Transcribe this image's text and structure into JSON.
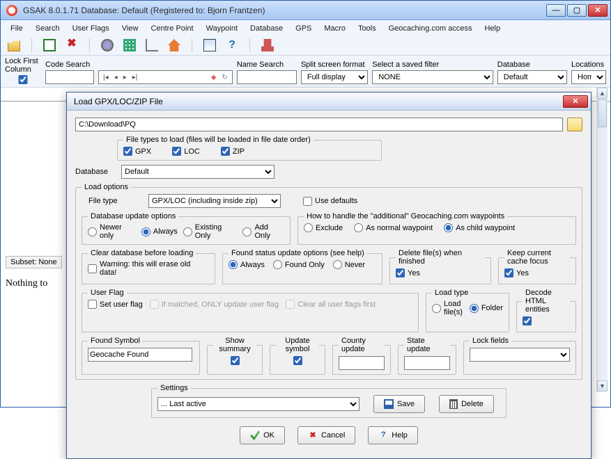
{
  "window": {
    "title": "GSAK 8.0.1.71   Database: Default    (Registered to: Bjorn Frantzen)"
  },
  "menu": [
    "File",
    "Search",
    "User Flags",
    "View",
    "Centre Point",
    "Waypoint",
    "Database",
    "GPS",
    "Macro",
    "Tools",
    "Geocaching.com access",
    "Help"
  ],
  "filters": {
    "lock_first": "Lock First\nColumn",
    "code_search": "Code Search",
    "name_search": "Name Search",
    "split_label": "Split screen format",
    "split_value": "Full display",
    "saved_filter_label": "Select a saved filter",
    "saved_filter_value": "NONE",
    "database_label": "Database",
    "database_value": "Default",
    "locations_label": "Locations",
    "locations_value": "Home"
  },
  "subset": "Subset: None",
  "nothing": "Nothing to",
  "dialog": {
    "title": "Load GPX/LOC/ZIP File",
    "path": "C:\\Download\\PQ",
    "filetypes_legend": "File types to load (files will be loaded in file date order)",
    "gpx": "GPX",
    "loc": "LOC",
    "zip": "ZIP",
    "database_label": "Database",
    "database_value": "Default",
    "loadopt_legend": "Load options",
    "filetype_label": "File type",
    "filetype_value": "GPX/LOC (including inside zip)",
    "use_defaults": "Use defaults",
    "dbupd_legend": "Database update options",
    "dbupd": {
      "newer": "Newer only",
      "always": "Always",
      "existing": "Existing Only",
      "add": "Add Only"
    },
    "addl_legend": "How to handle the \"additional\" Geocaching.com waypoints",
    "addl": {
      "exclude": "Exclude",
      "normal": "As normal waypoint",
      "child": "As child waypoint"
    },
    "clear_legend": "Clear database before loading",
    "clear_warn": "Warning: this will erase old data!",
    "found_legend": "Found status update options (see help)",
    "found": {
      "always": "Always",
      "only": "Found Only",
      "never": "Never"
    },
    "delete_legend": "Delete file(s) when finished",
    "yes": "Yes",
    "keep_legend": "Keep current cache focus",
    "userflag_legend": "User Flag",
    "setuser": "Set user flag",
    "ifmatched": "If matched, ONLY update user flag",
    "clearall": "Clear all user flags first",
    "loadtype_legend": "Load type",
    "loadtype": {
      "file": "Load file(s)",
      "folder": "Folder"
    },
    "decode_legend": "Decode HTML entities",
    "foundsym_legend": "Found Symbol",
    "foundsym_value": "Geocache Found",
    "showsum_legend": "Show summary",
    "updsym_legend": "Update symbol",
    "county_legend": "County update",
    "state_legend": "State update",
    "lock_legend": "Lock fields",
    "settings_legend": "Settings",
    "settings_value": "... Last active",
    "save": "Save",
    "delete": "Delete",
    "ok": "OK",
    "cancel": "Cancel",
    "help": "Help"
  }
}
